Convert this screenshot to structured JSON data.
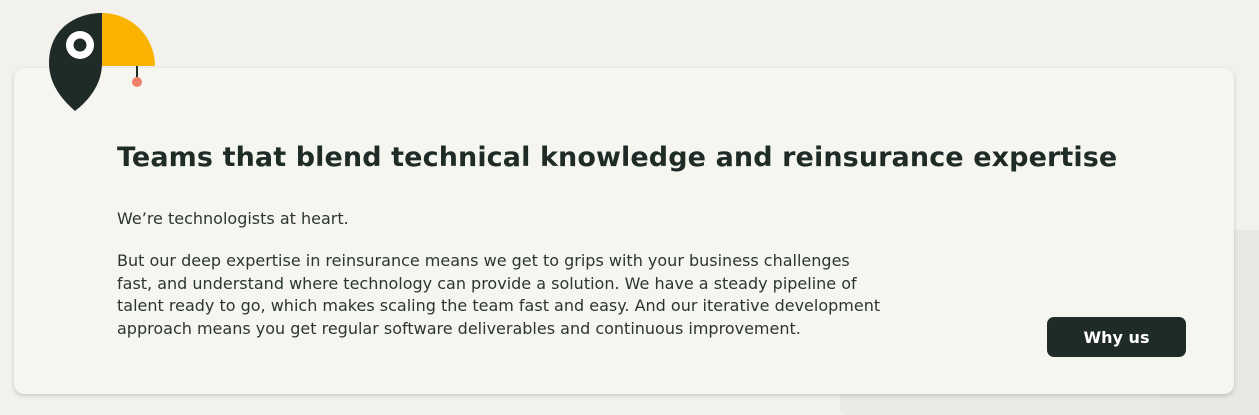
{
  "brand": {
    "logo_icon": "toucan-logo-icon",
    "colors": {
      "dark": "#1f2b27",
      "yellow": "#f9b200",
      "coral": "#f1806a",
      "white": "#ffffff"
    }
  },
  "card": {
    "heading": "Teams that blend technical knowledge and reinsurance expertise",
    "intro": "We’re technologists at heart.",
    "body_lines": [
      "But our deep expertise in reinsurance means we get to grips with your business challenges",
      "fast, and understand where technology can provide a solution. We have a steady pipeline of",
      "talent ready to go, which makes scaling the team fast and easy. And our iterative development",
      "approach means you get regular software deliverables and continuous improvement."
    ],
    "cta_label": "Why us"
  }
}
